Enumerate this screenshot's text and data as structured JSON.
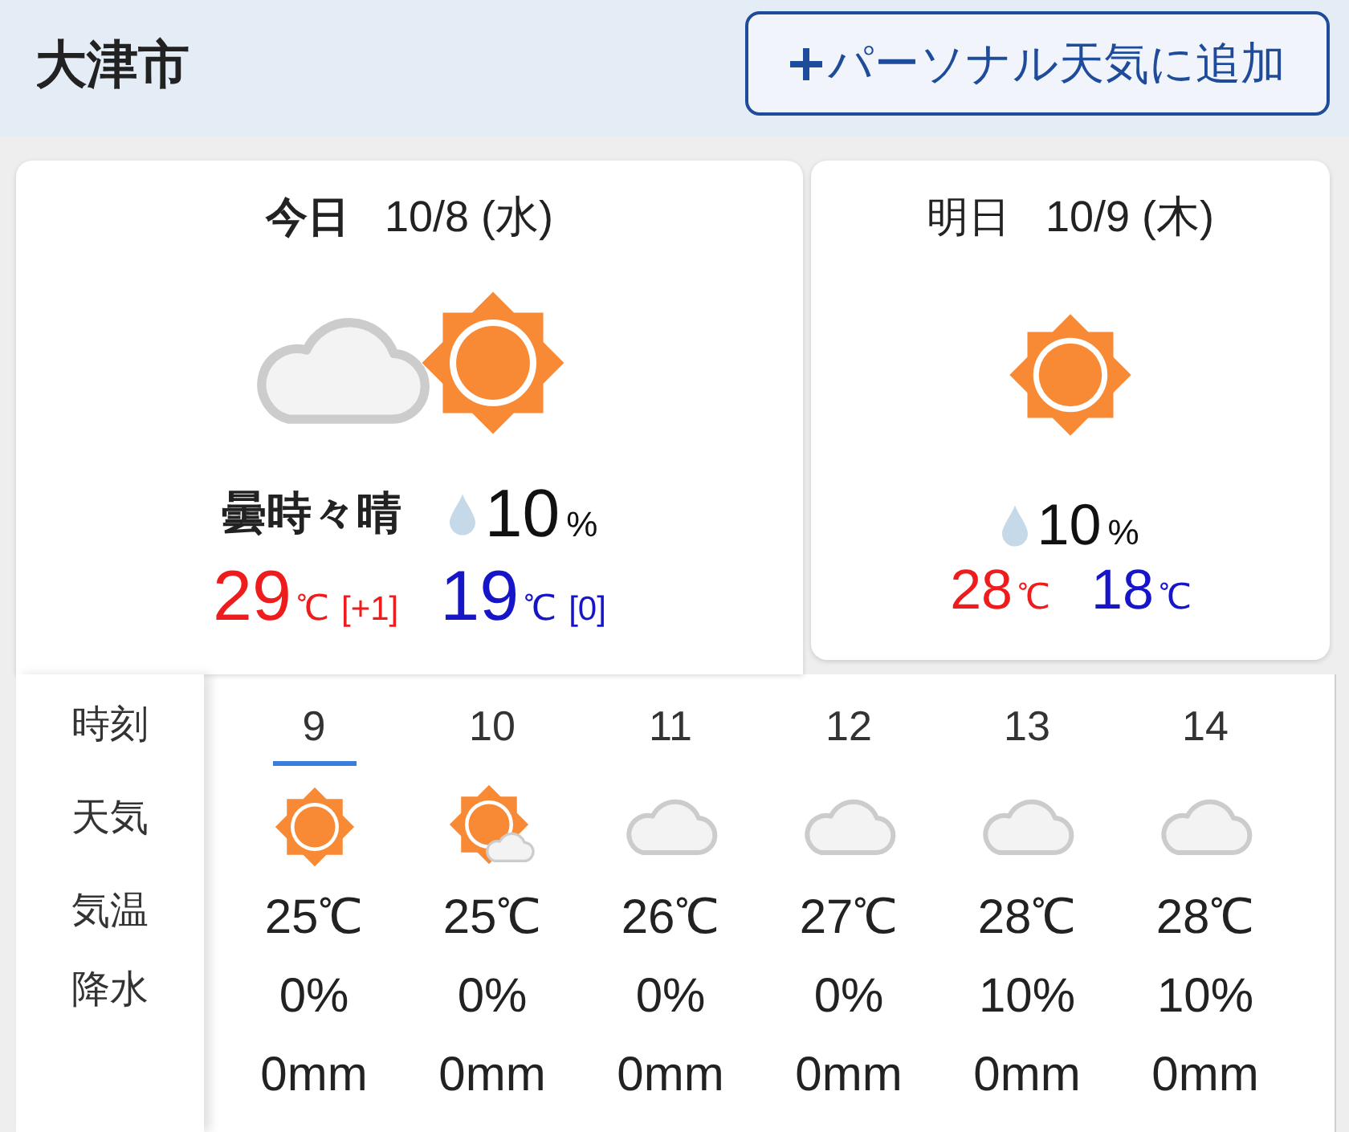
{
  "header": {
    "title": "大津市",
    "add_button": {
      "label": "パーソナル天気に追加"
    }
  },
  "days": [
    {
      "kind": "today",
      "label": "今日",
      "date": "10/8 (水)",
      "weather": {
        "kind": "cloudy_sunny",
        "text": "曇時々晴"
      },
      "precip": {
        "chance": "10",
        "unit": "%"
      },
      "high": {
        "value": "29",
        "unit": "℃",
        "diff": "[+1]"
      },
      "low": {
        "value": "19",
        "unit": "℃",
        "diff": "[0]"
      }
    },
    {
      "kind": "tomorrow",
      "label": "明日",
      "date": "10/9 (木)",
      "weather": {
        "kind": "sunny"
      },
      "precip": {
        "chance": "10",
        "unit": "%"
      },
      "high": {
        "value": "28",
        "unit": "℃"
      },
      "low": {
        "value": "18",
        "unit": "℃"
      }
    }
  ],
  "hourly": {
    "row_labels": [
      "時刻",
      "天気",
      "気温",
      "降水"
    ],
    "hours": [
      {
        "hour": "9",
        "selected": true,
        "kind": "sunny",
        "temp": "25℃",
        "precip_chance": "0%",
        "precip_amount": "0mm"
      },
      {
        "hour": "10",
        "selected": false,
        "kind": "sunny_cloudy",
        "temp": "25℃",
        "precip_chance": "0%",
        "precip_amount": "0mm"
      },
      {
        "hour": "11",
        "selected": false,
        "kind": "cloudy",
        "temp": "26℃",
        "precip_chance": "0%",
        "precip_amount": "0mm"
      },
      {
        "hour": "12",
        "selected": false,
        "kind": "cloudy",
        "temp": "27℃",
        "precip_chance": "0%",
        "precip_amount": "0mm"
      },
      {
        "hour": "13",
        "selected": false,
        "kind": "cloudy",
        "temp": "28℃",
        "precip_chance": "10%",
        "precip_amount": "0mm"
      },
      {
        "hour": "14",
        "selected": false,
        "kind": "cloudy",
        "temp": "28℃",
        "precip_chance": "10%",
        "precip_amount": "0mm"
      }
    ]
  }
}
